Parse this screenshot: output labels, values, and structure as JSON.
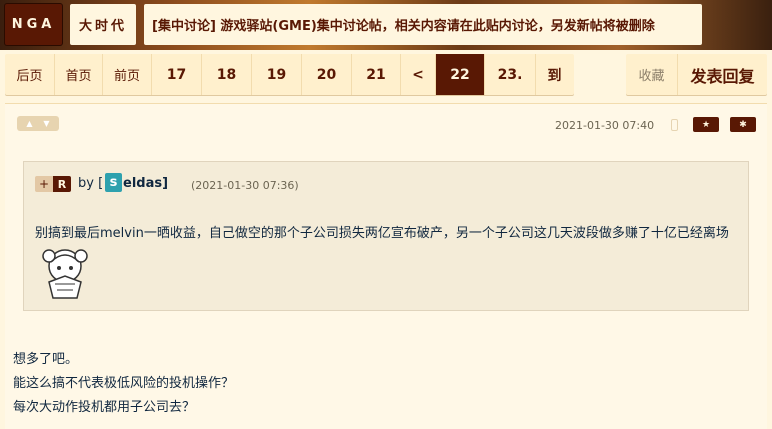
{
  "header": {
    "logo": "NGA",
    "forum": "大时代",
    "thread_title": "[集中讨论] 游戏驿站(GME)集中讨论帖，相关内容请在此贴内讨论，另发新帖将被删除"
  },
  "pager": {
    "first": "后页",
    "home": "首页",
    "prev": "前页",
    "pages": [
      "17",
      "18",
      "19",
      "20",
      "21"
    ],
    "back": "<",
    "current": "22",
    "next_page": "23.",
    "goto": "到"
  },
  "actions": {
    "favorite": "收藏",
    "reply": "发表回复"
  },
  "post": {
    "time": "2021-01-30 07:40",
    "quote": {
      "plus": "+",
      "badge": "R",
      "by": "by [",
      "avatar_letter": "s",
      "user": "eldas]",
      "time": "(2021-01-30 07:36)",
      "text": "别搞到最后melvin一晒收益，自己做空的那个子公司损失两亿宣布破产，另一个子公司这几天波段做多赚了十亿已经离场"
    },
    "lines": [
      "想多了吧。",
      "能这么搞不代表极低风险的投机操作？",
      "每次大动作投机都用子公司去？"
    ]
  },
  "icons": {
    "vote": "thumb-icon",
    "device": "phone-icon",
    "star": "star-icon",
    "gear": "gear-icon",
    "emoji": "anime-girl-emoji"
  },
  "colors": {
    "brand_dark": "#591804",
    "bg": "#fff6df",
    "avatar": "#2ea1ae"
  }
}
